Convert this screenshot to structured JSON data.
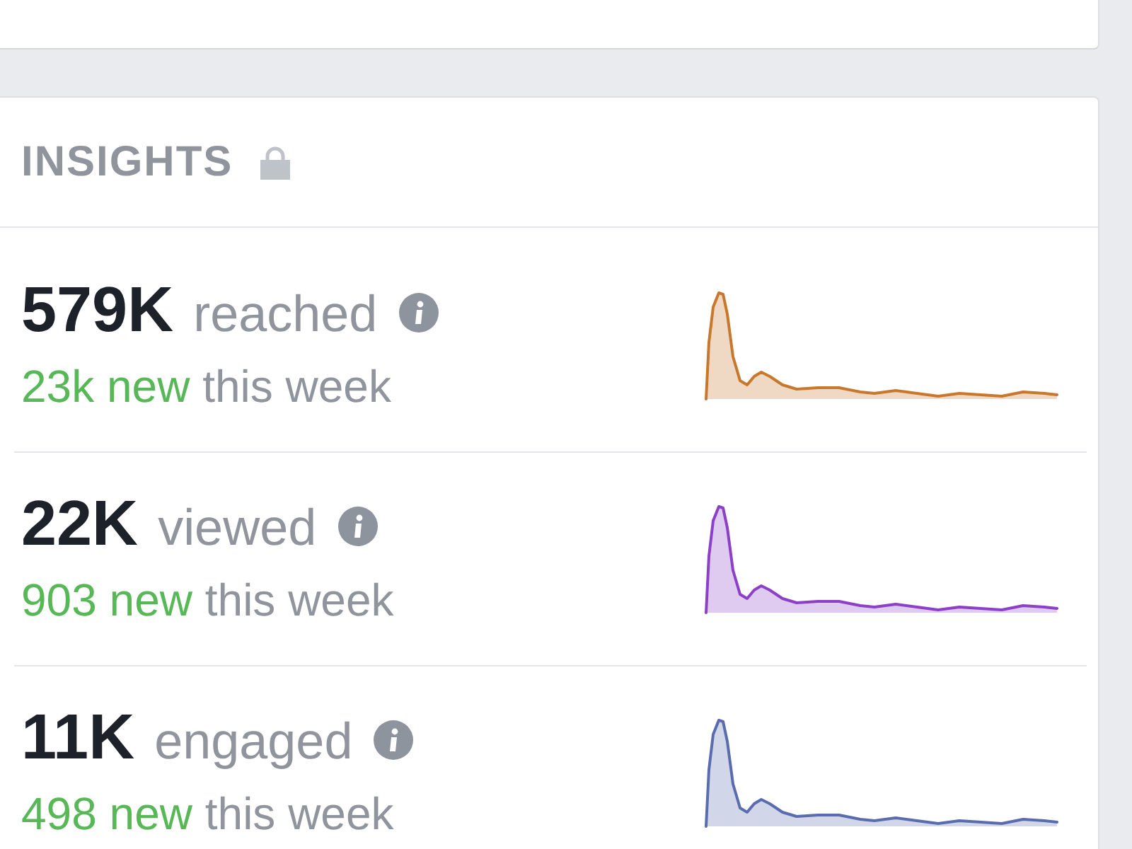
{
  "insights": {
    "title": "INSIGHTS",
    "locked": true,
    "metrics": [
      {
        "value": "579K",
        "label": "reached",
        "new_count": "23k new",
        "period": "this week",
        "color": "#c8782c"
      },
      {
        "value": "22K",
        "label": "viewed",
        "new_count": "903 new",
        "period": "this week",
        "color": "#8c40c8"
      },
      {
        "value": "11K",
        "label": "engaged",
        "new_count": "498 new",
        "period": "this week",
        "color": "#5a6cae"
      }
    ]
  }
}
